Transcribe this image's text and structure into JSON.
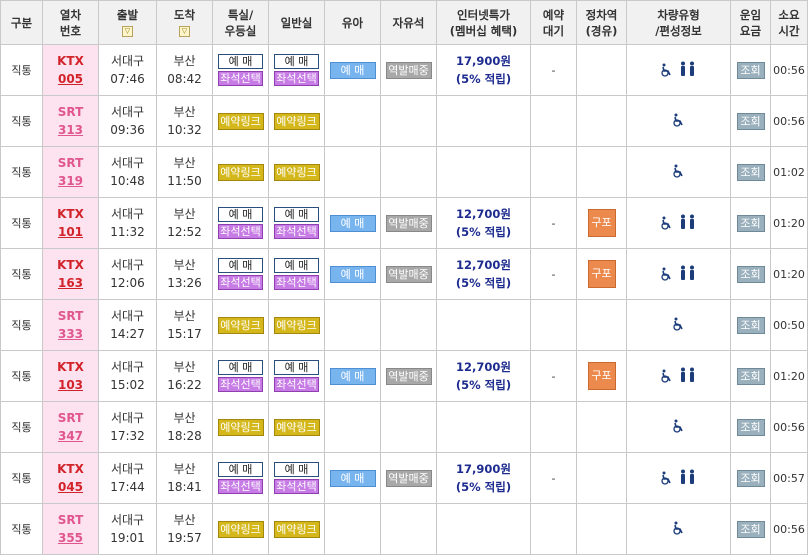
{
  "headers": {
    "type": "구분",
    "train": [
      "열차",
      "번호"
    ],
    "dep": "출발",
    "arr": "도착",
    "special": [
      "특실/",
      "우등실"
    ],
    "general": "일반실",
    "infant": "유아",
    "free_seat": "자유석",
    "internet": [
      "인터넷특가",
      "(멤버십 혜택)"
    ],
    "reserve": [
      "예약",
      "대기"
    ],
    "transfer": [
      "정차역",
      "(경유)"
    ],
    "vehicle": [
      "차량유형",
      "/편성정보"
    ],
    "fare": [
      "운임",
      "요금"
    ],
    "duration": [
      "소요",
      "시간"
    ]
  },
  "labels": {
    "book": "예 매",
    "seat_select": "좌석선택",
    "reserve_link": "예약링크",
    "infant_book": "예 매",
    "standing": "역발매중",
    "view": "조회",
    "dash": "-",
    "transfer_station": "구포"
  },
  "colors": {
    "ktx": "#d2232a",
    "srt": "#e0568e",
    "train_cell_bg": "#fde2ef",
    "seat_select": "#c77be4",
    "reserve_link": "#d4b71b",
    "infant": "#78b4ee",
    "standing": "#a8a8a8",
    "view": "#9ab0bd",
    "transfer": "#ec8a4e",
    "fare_text": "#1d2b8f"
  },
  "icons": [
    "sort-icon",
    "wheelchair-icon",
    "family-icon"
  ],
  "rows": [
    {
      "type": "직통",
      "train": "KTX",
      "no": "005",
      "dep_station": "서대구",
      "dep_time": "07:46",
      "arr_station": "부산",
      "arr_time": "08:42",
      "mode": "ktx",
      "fare": "17,900원",
      "fare_note": "(5% 적립)",
      "reserve": "-",
      "transfer": "",
      "duration": "00:56"
    },
    {
      "type": "직통",
      "train": "SRT",
      "no": "313",
      "dep_station": "서대구",
      "dep_time": "09:36",
      "arr_station": "부산",
      "arr_time": "10:32",
      "mode": "srt",
      "fare": "",
      "fare_note": "",
      "reserve": "",
      "transfer": "",
      "duration": "00:56"
    },
    {
      "type": "직통",
      "train": "SRT",
      "no": "319",
      "dep_station": "서대구",
      "dep_time": "10:48",
      "arr_station": "부산",
      "arr_time": "11:50",
      "mode": "srt",
      "fare": "",
      "fare_note": "",
      "reserve": "",
      "transfer": "",
      "duration": "01:02"
    },
    {
      "type": "직통",
      "train": "KTX",
      "no": "101",
      "dep_station": "서대구",
      "dep_time": "11:32",
      "arr_station": "부산",
      "arr_time": "12:52",
      "mode": "ktx",
      "fare": "12,700원",
      "fare_note": "(5% 적립)",
      "reserve": "-",
      "transfer": "구포",
      "duration": "01:20"
    },
    {
      "type": "직통",
      "train": "KTX",
      "no": "163",
      "dep_station": "서대구",
      "dep_time": "12:06",
      "arr_station": "부산",
      "arr_time": "13:26",
      "mode": "ktx",
      "fare": "12,700원",
      "fare_note": "(5% 적립)",
      "reserve": "-",
      "transfer": "구포",
      "duration": "01:20"
    },
    {
      "type": "직통",
      "train": "SRT",
      "no": "333",
      "dep_station": "서대구",
      "dep_time": "14:27",
      "arr_station": "부산",
      "arr_time": "15:17",
      "mode": "srt",
      "fare": "",
      "fare_note": "",
      "reserve": "",
      "transfer": "",
      "duration": "00:50"
    },
    {
      "type": "직통",
      "train": "KTX",
      "no": "103",
      "dep_station": "서대구",
      "dep_time": "15:02",
      "arr_station": "부산",
      "arr_time": "16:22",
      "mode": "ktx",
      "fare": "12,700원",
      "fare_note": "(5% 적립)",
      "reserve": "-",
      "transfer": "구포",
      "duration": "01:20"
    },
    {
      "type": "직통",
      "train": "SRT",
      "no": "347",
      "dep_station": "서대구",
      "dep_time": "17:32",
      "arr_station": "부산",
      "arr_time": "18:28",
      "mode": "srt",
      "fare": "",
      "fare_note": "",
      "reserve": "",
      "transfer": "",
      "duration": "00:56"
    },
    {
      "type": "직통",
      "train": "KTX",
      "no": "045",
      "dep_station": "서대구",
      "dep_time": "17:44",
      "arr_station": "부산",
      "arr_time": "18:41",
      "mode": "ktx",
      "fare": "17,900원",
      "fare_note": "(5% 적립)",
      "reserve": "-",
      "transfer": "",
      "duration": "00:57"
    },
    {
      "type": "직통",
      "train": "SRT",
      "no": "355",
      "dep_station": "서대구",
      "dep_time": "19:01",
      "arr_station": "부산",
      "arr_time": "19:57",
      "mode": "srt",
      "fare": "",
      "fare_note": "",
      "reserve": "",
      "transfer": "",
      "duration": "00:56"
    }
  ]
}
